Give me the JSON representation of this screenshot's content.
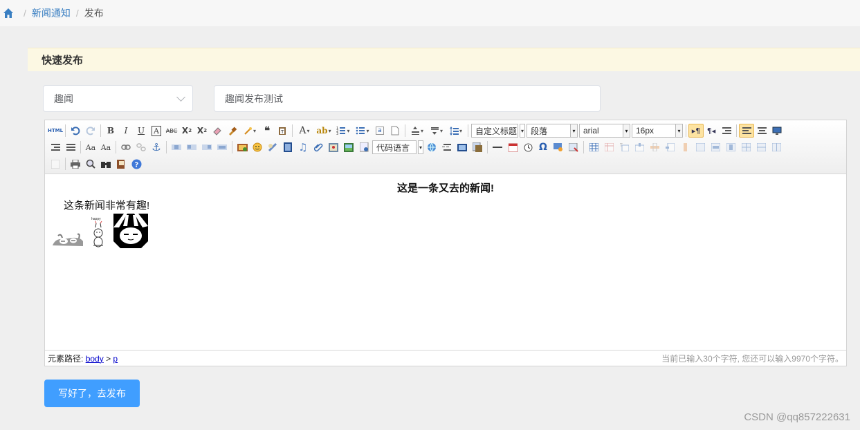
{
  "breadcrumb": {
    "items": [
      {
        "label": "新闻通知"
      },
      {
        "label": "发布"
      }
    ]
  },
  "panel": {
    "title": "快速发布"
  },
  "form": {
    "category": "趣闻",
    "title_value": "趣闻发布测试",
    "submit_label": "写好了，去发布"
  },
  "editor": {
    "toolbar": {
      "heading_select": "自定义标题",
      "paragraph_select": "段落",
      "font_family_select": "arial",
      "font_size_select": "16px",
      "code_language_select": "代码语言",
      "html_label": "HTML"
    },
    "content": {
      "headline": "这是一条又去的新闻!",
      "paragraph": "这条新闻非常有趣!"
    },
    "status": {
      "path_label": "元素路径:",
      "path_body": "body",
      "path_sep": ">",
      "path_p": "p",
      "char_count": "当前已输入30个字符, 您还可以输入9970个字符。"
    }
  },
  "watermark": "CSDN @qq857222631",
  "colors": {
    "primary": "#409eff",
    "panel_bg": "#fcf8e3",
    "link": "#3a7fc2"
  }
}
